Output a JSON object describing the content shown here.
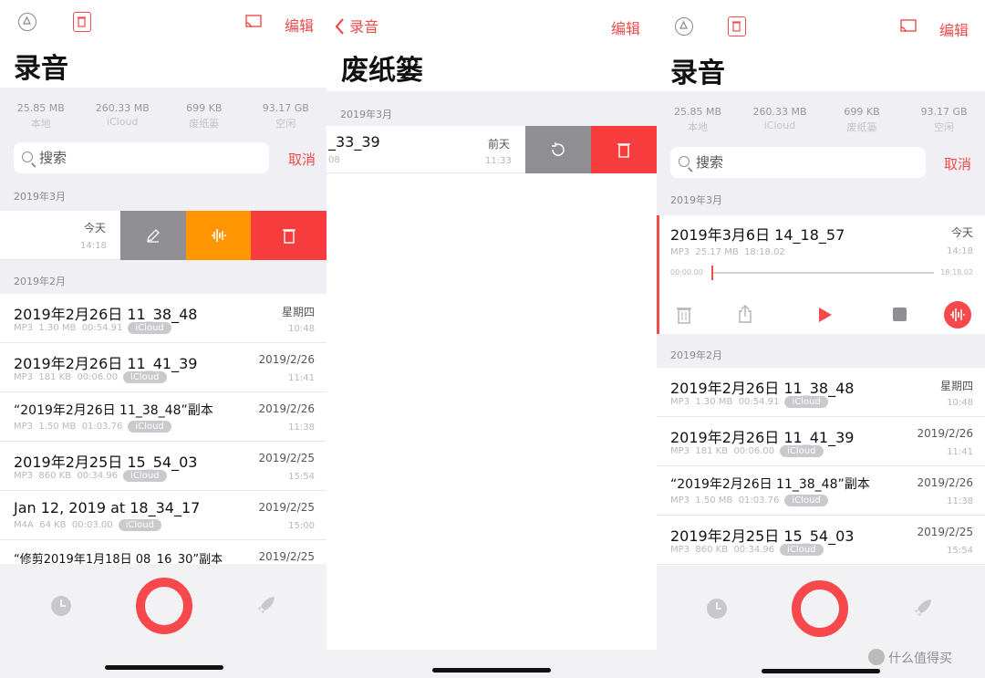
{
  "panels": {
    "left": {
      "title": "录音",
      "edit_label": "编辑",
      "stats": [
        {
          "value": "25.85 MB",
          "label": "本地"
        },
        {
          "value": "260.33 MB",
          "label": "iCloud"
        },
        {
          "value": "699 KB",
          "label": "废纸篓"
        },
        {
          "value": "93.17 GB",
          "label": "空闲"
        }
      ],
      "search_placeholder": "搜索",
      "cancel_label": "取消",
      "section_march": "2019年3月",
      "swiped_row": {
        "date": "今天",
        "time": "14:18"
      },
      "section_feb": "2019年2月",
      "rows": [
        {
          "title": "2019年2月26日 11_38_48",
          "format": "MP3",
          "size": "1.30 MB",
          "duration": "00:54.91",
          "badge": "iCloud",
          "date": "星期四",
          "time": "10:48"
        },
        {
          "title": "2019年2月26日 11_41_39",
          "format": "MP3",
          "size": "181 KB",
          "duration": "00:06.00",
          "badge": "iCloud",
          "date": "2019/2/26",
          "time": "11:41"
        },
        {
          "title": "“2019年2月26日 11_38_48”副本",
          "format": "MP3",
          "size": "1.50 MB",
          "duration": "01:03.76",
          "badge": "iCloud",
          "date": "2019/2/26",
          "time": "11:38"
        },
        {
          "title": "2019年2月25日 15_54_03",
          "format": "MP3",
          "size": "860 KB",
          "duration": "00:34.96",
          "badge": "iCloud",
          "date": "2019/2/25",
          "time": "15:54"
        },
        {
          "title": "Jan 12, 2019 at 18_34_17",
          "format": "M4A",
          "size": "64 KB",
          "duration": "00:03.00",
          "badge": "iCloud",
          "date": "2019/2/25",
          "time": "15:00"
        },
        {
          "title": "“修剪2019年1月18日 08_16_30”副本",
          "date": "2019/2/25"
        }
      ]
    },
    "middle": {
      "back_label": "录音",
      "edit_label": "编辑",
      "title": "废纸篓",
      "section": "2019年3月",
      "row": {
        "title": "_33_39",
        "meta": "08",
        "date": "前天",
        "time": "11:33"
      }
    },
    "right": {
      "title": "录音",
      "edit_label": "编辑",
      "stats": [
        {
          "value": "25.85 MB",
          "label": "本地"
        },
        {
          "value": "260.33 MB",
          "label": "iCloud"
        },
        {
          "value": "699 KB",
          "label": "废纸篓"
        },
        {
          "value": "93.17 GB",
          "label": "空闲"
        }
      ],
      "search_placeholder": "搜索",
      "cancel_label": "取消",
      "section_march": "2019年3月",
      "expanded": {
        "title": "2019年3月6日 14_18_57",
        "format": "MP3",
        "size": "25.17 MB",
        "duration": "18:18.02",
        "date": "今天",
        "time": "14:18",
        "pos_start": "00:00.00",
        "pos_end": "18:18.02"
      },
      "section_feb": "2019年2月",
      "rows": [
        {
          "title": "2019年2月26日 11_38_48",
          "format": "MP3",
          "size": "1.30 MB",
          "duration": "00:54.91",
          "badge": "iCloud",
          "date": "星期四",
          "time": "10:48"
        },
        {
          "title": "2019年2月26日 11_41_39",
          "format": "MP3",
          "size": "181 KB",
          "duration": "00:06.00",
          "badge": "iCloud",
          "date": "2019/2/26",
          "time": "11:41"
        },
        {
          "title": "“2019年2月26日 11_38_48”副本",
          "format": "MP3",
          "size": "1.50 MB",
          "duration": "01:03.76",
          "badge": "iCloud",
          "date": "2019/2/26",
          "time": "11:38"
        },
        {
          "title": "2019年2月25日 15_54_03",
          "format": "MP3",
          "size": "860 KB",
          "duration": "00:34.96",
          "badge": "iCloud",
          "date": "2019/2/25",
          "time": "15:54"
        }
      ]
    }
  },
  "watermark": "什么值得买",
  "colors": {
    "accent": "#f24b4b",
    "orange": "#ff9500",
    "swipe_gray": "#8e8e93"
  }
}
